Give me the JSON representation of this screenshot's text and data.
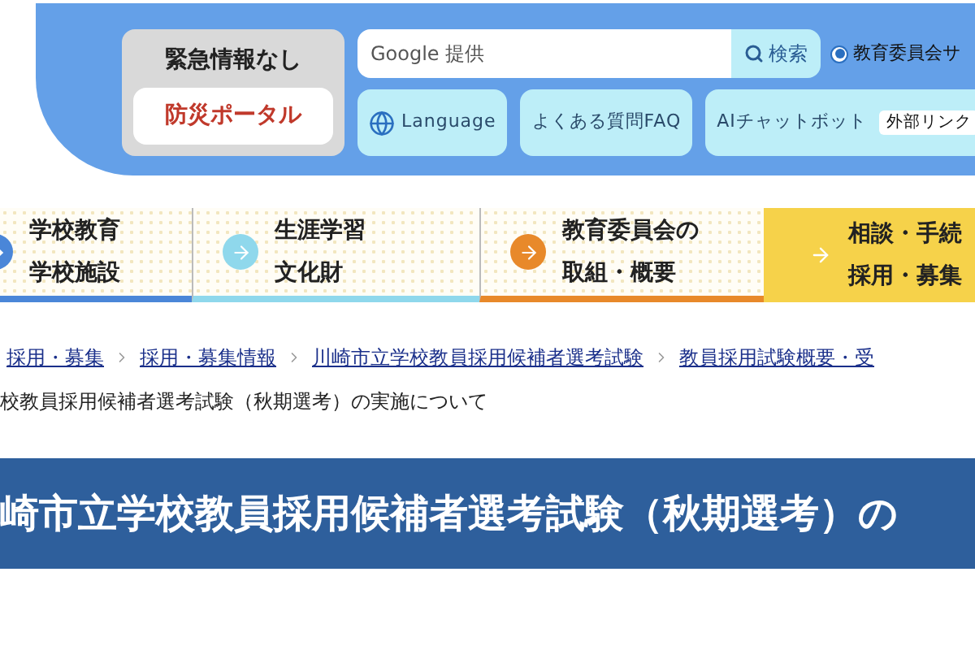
{
  "header": {
    "emergency": {
      "status": "緊急情報なし",
      "portal_button": "防災ポータル"
    },
    "search": {
      "placeholder": "Google 提供",
      "button": "検索",
      "scope": {
        "label": "教育委員会サ",
        "selected": true
      }
    },
    "links": [
      {
        "kind": "language",
        "label": "Language"
      },
      {
        "kind": "plain",
        "label": "よくある質問FAQ"
      },
      {
        "kind": "external",
        "label": "AIチャットボット",
        "badge": "外部リンク"
      }
    ]
  },
  "nav": [
    {
      "lines": [
        "学校教育",
        "学校施設"
      ],
      "color": "#4a86d8",
      "selected": false
    },
    {
      "lines": [
        "生涯学習",
        "文化財"
      ],
      "color": "#8fd8ec",
      "selected": false
    },
    {
      "lines": [
        "教育委員会の",
        "取組・概要"
      ],
      "color": "#e8892a",
      "selected": false
    },
    {
      "lines": [
        "相談・手続",
        "採用・募集"
      ],
      "color": "#f6d24a",
      "selected": true
    }
  ],
  "breadcrumb": [
    "採用・募集",
    "採用・募集情報",
    "川崎市立学校教員採用候補者選考試験",
    "教員採用試験概要・受"
  ],
  "current_page": "校教員採用候補者選考試験（秋期選考）の実施について",
  "page_title": "崎市立学校教員採用候補者選考試験（秋期選考）の"
}
